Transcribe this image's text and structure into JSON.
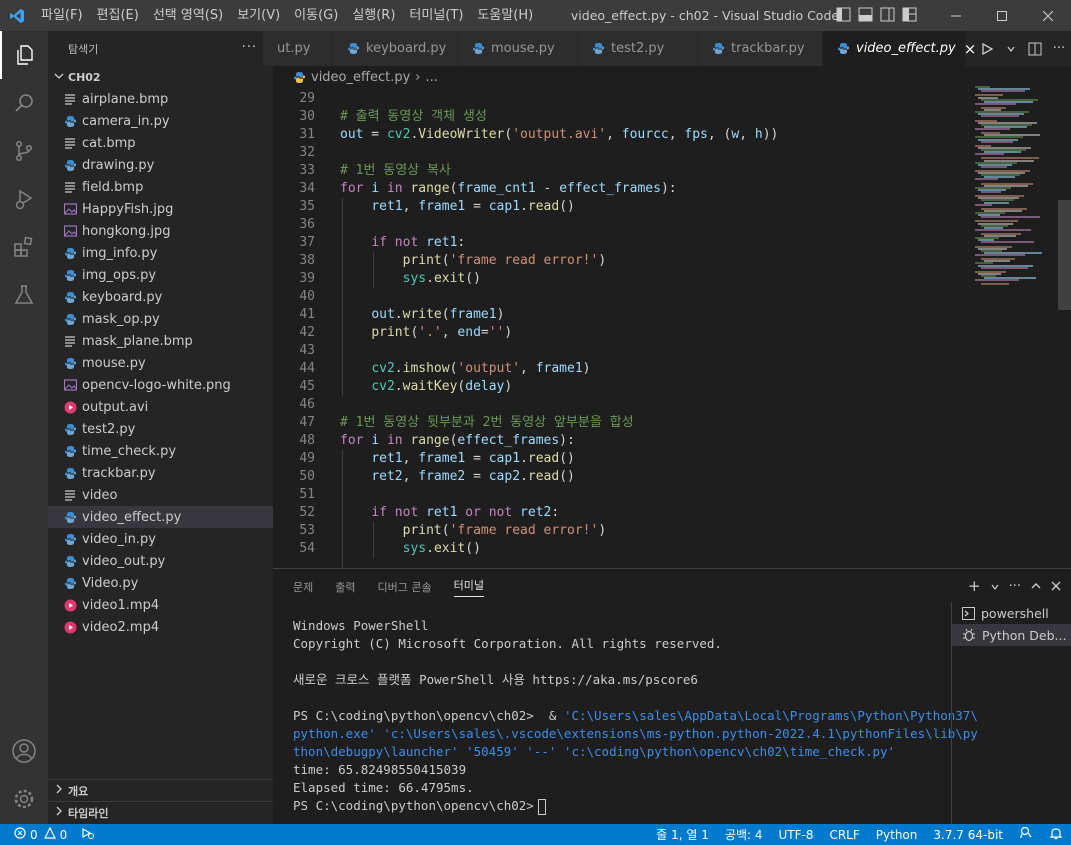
{
  "titlebar": {
    "menus": [
      "파일(F)",
      "편집(E)",
      "선택 영역(S)",
      "보기(V)",
      "이동(G)",
      "실행(R)",
      "터미널(T)",
      "도움말(H)"
    ],
    "title": "video_effect.py - ch02 - Visual Studio Code"
  },
  "activity": [
    "explorer-icon",
    "search-icon",
    "source-control-icon",
    "run-debug-icon",
    "extensions-icon",
    "testing-icon",
    "account-icon",
    "gear-icon"
  ],
  "sidebar": {
    "header": "탐색기",
    "more": "···",
    "folder": "CH02",
    "files": [
      {
        "name": "airplane.bmp",
        "type": "bmp"
      },
      {
        "name": "camera_in.py",
        "type": "py"
      },
      {
        "name": "cat.bmp",
        "type": "bmp"
      },
      {
        "name": "drawing.py",
        "type": "py"
      },
      {
        "name": "field.bmp",
        "type": "bmp"
      },
      {
        "name": "HappyFish.jpg",
        "type": "img"
      },
      {
        "name": "hongkong.jpg",
        "type": "img"
      },
      {
        "name": "img_info.py",
        "type": "py"
      },
      {
        "name": "img_ops.py",
        "type": "py"
      },
      {
        "name": "keyboard.py",
        "type": "py"
      },
      {
        "name": "mask_op.py",
        "type": "py"
      },
      {
        "name": "mask_plane.bmp",
        "type": "bmp"
      },
      {
        "name": "mouse.py",
        "type": "py"
      },
      {
        "name": "opencv-logo-white.png",
        "type": "img"
      },
      {
        "name": "output.avi",
        "type": "video"
      },
      {
        "name": "test2.py",
        "type": "py"
      },
      {
        "name": "time_check.py",
        "type": "py"
      },
      {
        "name": "trackbar.py",
        "type": "py"
      },
      {
        "name": "video",
        "type": "bmp"
      },
      {
        "name": "video_effect.py",
        "type": "py",
        "selected": true
      },
      {
        "name": "video_in.py",
        "type": "py"
      },
      {
        "name": "video_out.py",
        "type": "py"
      },
      {
        "name": "Video.py",
        "type": "py"
      },
      {
        "name": "video1.mp4",
        "type": "video"
      },
      {
        "name": "video2.mp4",
        "type": "video"
      }
    ],
    "outline": "개요",
    "timeline": "타임라인"
  },
  "tabs": [
    {
      "label": "ut.py"
    },
    {
      "label": "keyboard.py"
    },
    {
      "label": "mouse.py"
    },
    {
      "label": "test2.py"
    },
    {
      "label": "trackbar.py"
    },
    {
      "label": "video_effect.py",
      "active": true
    }
  ],
  "tab_close": "×",
  "breadcrumb": {
    "file": "video_effect.py",
    "sep": "›",
    "rest": "..."
  },
  "editor": {
    "lines": [
      {
        "n": "29",
        "code": ""
      },
      {
        "n": "30",
        "code": "# 출력 동영상 객체 생성"
      },
      {
        "n": "31",
        "code": "out = cv2.VideoWriter('output.avi', fourcc, fps, (w, h))"
      },
      {
        "n": "32",
        "code": ""
      },
      {
        "n": "33",
        "code": "# 1번 동영상 복사"
      },
      {
        "n": "34",
        "code": "for i in range(frame_cnt1 - effect_frames):"
      },
      {
        "n": "35",
        "code": "    ret1, frame1 = cap1.read()"
      },
      {
        "n": "36",
        "code": ""
      },
      {
        "n": "37",
        "code": "    if not ret1:"
      },
      {
        "n": "38",
        "code": "        print('frame read error!')"
      },
      {
        "n": "39",
        "code": "        sys.exit()"
      },
      {
        "n": "40",
        "code": ""
      },
      {
        "n": "41",
        "code": "    out.write(frame1)"
      },
      {
        "n": "42",
        "code": "    print('.', end='')"
      },
      {
        "n": "43",
        "code": ""
      },
      {
        "n": "44",
        "code": "    cv2.imshow('output', frame1)"
      },
      {
        "n": "45",
        "code": "    cv2.waitKey(delay)"
      },
      {
        "n": "46",
        "code": ""
      },
      {
        "n": "47",
        "code": "# 1번 동영상 뒷부분과 2번 동영상 앞부분을 합성"
      },
      {
        "n": "48",
        "code": "for i in range(effect_frames):"
      },
      {
        "n": "49",
        "code": "    ret1, frame1 = cap1.read()"
      },
      {
        "n": "50",
        "code": "    ret2, frame2 = cap2.read()"
      },
      {
        "n": "51",
        "code": ""
      },
      {
        "n": "52",
        "code": "    if not ret1 or not ret2:"
      },
      {
        "n": "53",
        "code": "        print('frame read error!')"
      },
      {
        "n": "54",
        "code": "        sys.exit()"
      }
    ]
  },
  "panel": {
    "tabs": [
      "문제",
      "출력",
      "디버그 콘솔",
      "터미널"
    ],
    "active_tab": 3,
    "add": "+",
    "terminal_lines": [
      {
        "text": "Windows PowerShell",
        "blue": false
      },
      {
        "text": "Copyright (C) Microsoft Corporation. All rights reserved.",
        "blue": false
      },
      {
        "text": "",
        "blue": false
      },
      {
        "text": "새로운 크로스 플랫폼 PowerShell 사용 https://aka.ms/pscore6",
        "blue": false
      },
      {
        "text": "",
        "blue": false
      },
      {
        "text": "PS C:\\coding\\python\\opencv\\ch02>  & 'C:\\Users\\sales\\AppData\\Local\\Programs\\Python\\Python37\\",
        "blue": false
      },
      {
        "text": "python.exe' 'c:\\Users\\sales\\.vscode\\extensions\\ms-python.python-2022.4.1\\pythonFiles\\lib\\py",
        "blue": true
      },
      {
        "text": "thon\\debugpy\\launcher' '50459' '--' 'c:\\coding\\python\\opencv\\ch02\\time_check.py'",
        "blue": true
      },
      {
        "text": "time: 65.82498550415039",
        "blue": false
      },
      {
        "text": "Elapsed time: 66.4795ms.",
        "blue": false
      },
      {
        "text": "PS C:\\coding\\python\\opencv\\ch02>",
        "blue": false,
        "cursor": true
      }
    ],
    "terminals": [
      {
        "label": "powershell",
        "icon": "terminal-icon"
      },
      {
        "label": "Python Deb...",
        "icon": "debug-icon",
        "selected": true
      }
    ]
  },
  "status": {
    "errors": "0",
    "warnings": "0",
    "position": "줄 1, 열 1",
    "spaces": "공백: 4",
    "encoding": "UTF-8",
    "eol": "CRLF",
    "language": "Python",
    "interpreter": "3.7.7 64-bit"
  },
  "colors": {
    "status_bar": "#007acc",
    "keyword": "#c586c0",
    "comment": "#6a9955",
    "string": "#ce9178",
    "variable": "#9cdcfe",
    "function": "#dcdcaa",
    "builtin": "#569cd6"
  }
}
